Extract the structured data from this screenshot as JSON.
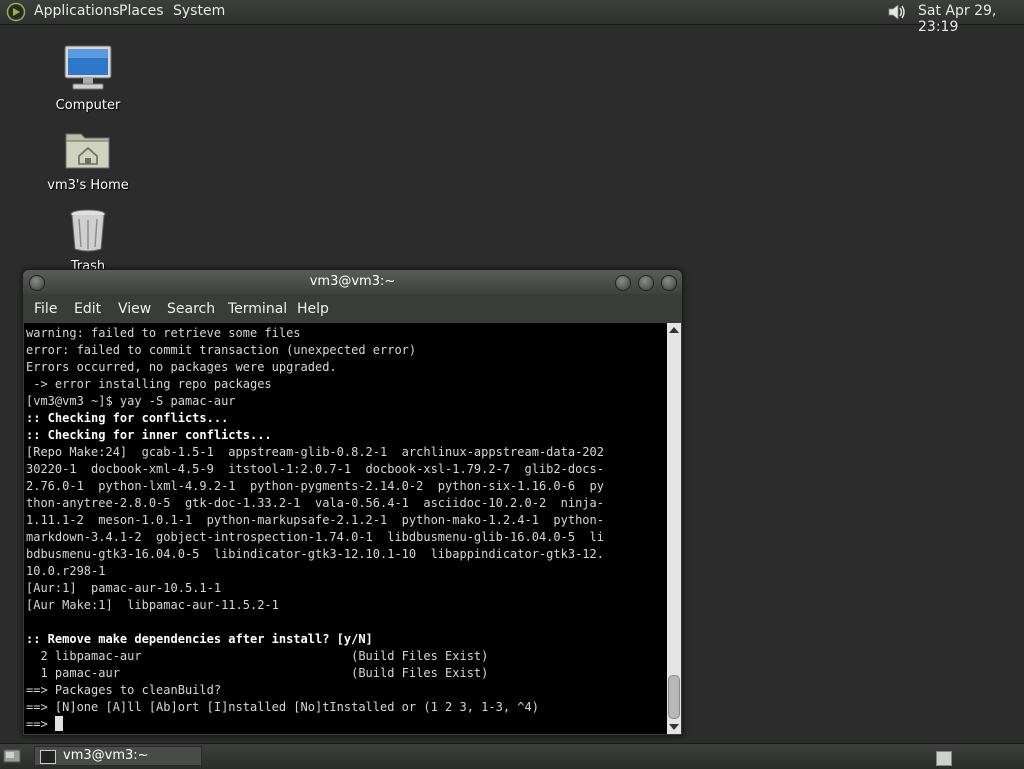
{
  "top_panel": {
    "menus": [
      "Applications",
      "Places",
      "System"
    ],
    "clock": "Sat Apr 29, 23:19",
    "icons": {
      "logo": "distro-logo-icon",
      "volume": "volume-icon"
    }
  },
  "desktop": {
    "icons": [
      {
        "label": "Computer",
        "icon": "computer-icon"
      },
      {
        "label": "vm3's Home",
        "icon": "home-folder-icon"
      },
      {
        "label": "Trash",
        "icon": "trash-icon"
      }
    ]
  },
  "terminal": {
    "title": "vm3@vm3:~",
    "menu": [
      "File",
      "Edit",
      "View",
      "Search",
      "Terminal",
      "Help"
    ],
    "lines": [
      "warning: failed to retrieve some files",
      "error: failed to commit transaction (unexpected error)",
      "Errors occurred, no packages were upgraded.",
      " -> error installing repo packages",
      "[vm3@vm3 ~]$ yay -S pamac-aur",
      ":: Checking for conflicts...",
      ":: Checking for inner conflicts...",
      "[Repo Make:24]  gcab-1.5-1  appstream-glib-0.8.2-1  archlinux-appstream-data-202",
      "30220-1  docbook-xml-4.5-9  itstool-1:2.0.7-1  docbook-xsl-1.79.2-7  glib2-docs-",
      "2.76.0-1  python-lxml-4.9.2-1  python-pygments-2.14.0-2  python-six-1.16.0-6  py",
      "thon-anytree-2.8.0-5  gtk-doc-1.33.2-1  vala-0.56.4-1  asciidoc-10.2.0-2  ninja-",
      "1.11.1-2  meson-1.0.1-1  python-markupsafe-2.1.2-1  python-mako-1.2.4-1  python-",
      "markdown-3.4.1-2  gobject-introspection-1.74.0-1  libdbusmenu-glib-16.04.0-5  li",
      "bdbusmenu-gtk3-16.04.0-5  libindicator-gtk3-12.10.1-10  libappindicator-gtk3-12.",
      "10.0.r298-1",
      "[Aur:1]  pamac-aur-10.5.1-1",
      "[Aur Make:1]  libpamac-aur-11.5.2-1",
      "",
      ":: Remove make dependencies after install? [y/N]",
      "  2 libpamac-aur                             (Build Files Exist)",
      "  1 pamac-aur                                (Build Files Exist)",
      "==> Packages to cleanBuild?",
      "==> [N]one [A]ll [Ab]ort [I]nstalled [No]tInstalled or (1 2 3, 1-3, ^4)",
      "==> "
    ],
    "bold_lines": [
      5,
      6,
      18
    ],
    "colors": {
      "background": "#000000",
      "text": "#d6d6d6",
      "bold_text": "#ffffff"
    }
  },
  "bottom_panel": {
    "task_label": "vm3@vm3:~",
    "icons": {
      "show_desktop": "show-desktop-icon",
      "task": "terminal-icon",
      "workspace": "workspace-switcher-icon"
    }
  }
}
